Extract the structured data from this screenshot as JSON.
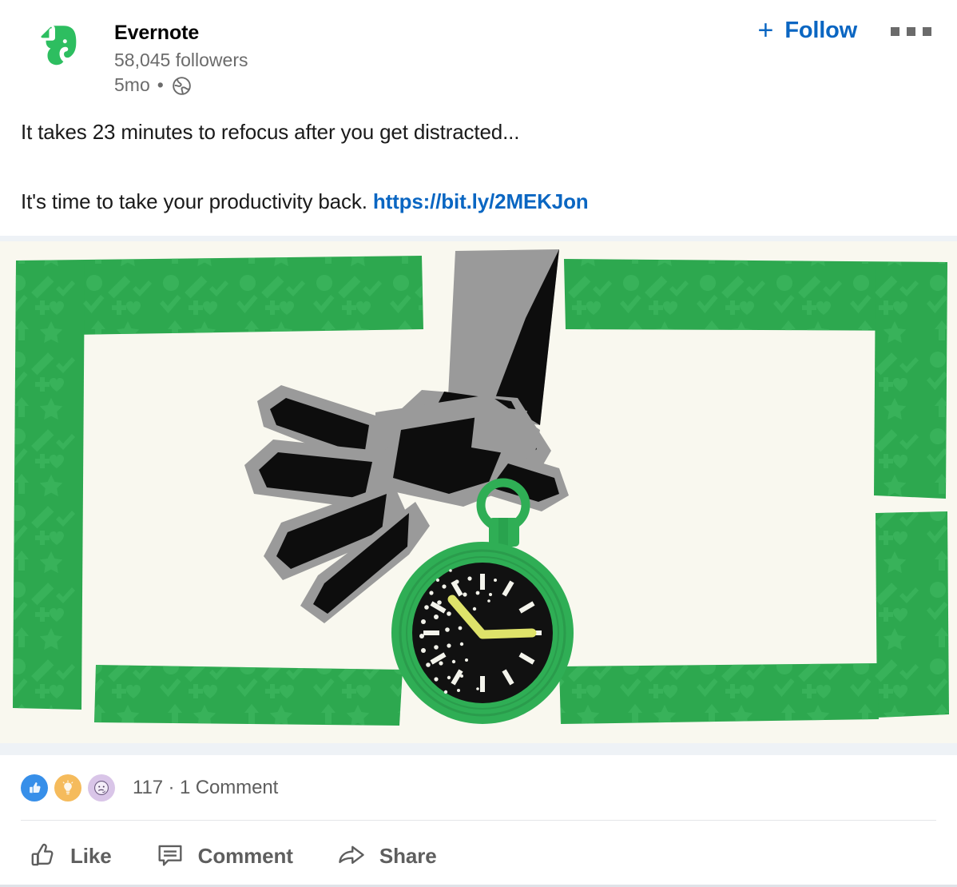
{
  "post": {
    "author": {
      "name": "Evernote",
      "followers": "58,045 followers",
      "time": "5mo",
      "separator": "•",
      "visibility_icon": "globe-icon",
      "avatar_icon": "evernote-elephant-logo",
      "brand_color": "#2DBE60"
    },
    "header_actions": {
      "follow_plus": "+",
      "follow_label": "Follow",
      "follow_color": "#0a66c2",
      "overflow_icon": "ellipsis-icon"
    },
    "body": {
      "line1": "It takes 23 minutes to refocus after you get distracted...",
      "line2_text": "It's time to take your productivity back. ",
      "line2_link": "https://bit.ly/2MEKJon"
    },
    "image": {
      "alt": "Illustration of a large gray hand reaching down toward a green stopwatch, framed by green washi tape printed with arrows, stars, hearts and checkmarks",
      "background_color": "#f9f8ef",
      "frame_color": "#2da84f",
      "frame_pattern_color": "#3fb961",
      "hand_color": "#9a9a9a",
      "hand_shadow_color": "#0d0d0d",
      "stopwatch_case_color": "#2fae55",
      "stopwatch_dial_color": "#111111",
      "stopwatch_hand_color": "#dfe36a",
      "letterbox_color": "#eef2f6"
    },
    "social": {
      "reactions": [
        {
          "name": "like",
          "icon": "thumbs-up-icon",
          "color": "#378fe9"
        },
        {
          "name": "insightful",
          "icon": "lightbulb-icon",
          "color": "#f5bb5c"
        },
        {
          "name": "curious",
          "icon": "thinking-face-icon",
          "color": "#d9c5e8"
        }
      ],
      "reaction_count": "117",
      "separator": "·",
      "comment_count": "1 Comment",
      "counts_label": "117 · 1 Comment"
    },
    "actions": [
      {
        "name": "like",
        "label": "Like",
        "icon": "thumbs-up-outline-icon"
      },
      {
        "name": "comment",
        "label": "Comment",
        "icon": "speech-bubble-icon"
      },
      {
        "name": "share",
        "label": "Share",
        "icon": "share-arrow-icon"
      }
    ]
  }
}
